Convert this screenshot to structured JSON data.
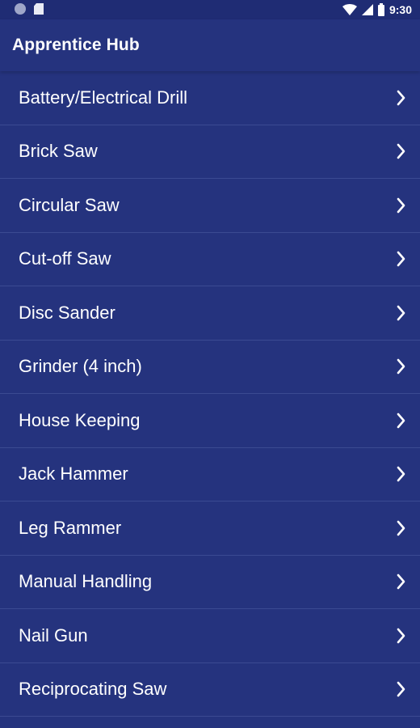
{
  "status_bar": {
    "time": "9:30",
    "icons": [
      "notification-circle-icon",
      "sdcard-icon",
      "wifi-icon",
      "cell-signal-icon",
      "battery-icon"
    ]
  },
  "app_bar": {
    "title": "Apprentice Hub"
  },
  "menu": {
    "items": [
      {
        "label": "Battery/Electrical Drill"
      },
      {
        "label": "Brick Saw"
      },
      {
        "label": "Circular Saw"
      },
      {
        "label": "Cut-off Saw"
      },
      {
        "label": "Disc Sander"
      },
      {
        "label": "Grinder (4 inch)"
      },
      {
        "label": "House Keeping"
      },
      {
        "label": "Jack Hammer"
      },
      {
        "label": "Leg Rammer"
      },
      {
        "label": "Manual Handling"
      },
      {
        "label": "Nail Gun"
      },
      {
        "label": "Reciprocating Saw"
      }
    ]
  },
  "colors": {
    "background": "#25337e",
    "divider": "#3b4a92",
    "text": "#ffffff"
  }
}
